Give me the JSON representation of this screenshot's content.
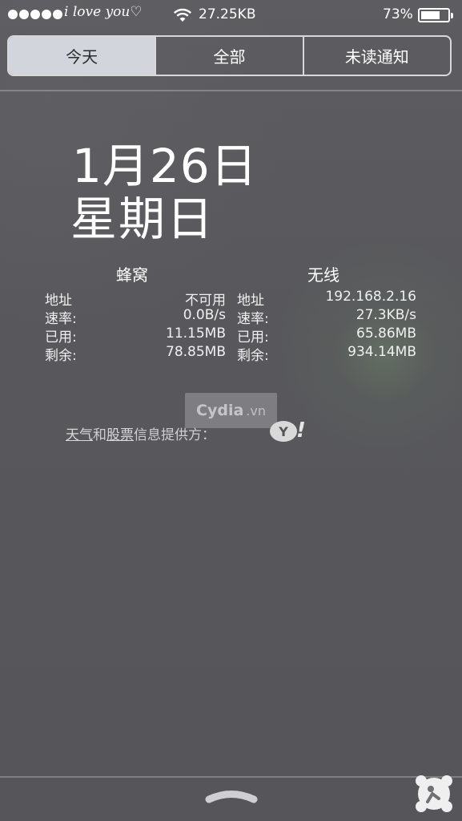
{
  "status_bar": {
    "carrier": "i love you♡",
    "network_speed": "27.25KB",
    "battery_percent": "73%",
    "battery_level": 0.73,
    "icons": [
      "signal-dots-icon",
      "wifi-icon",
      "battery-icon"
    ]
  },
  "tabs": [
    {
      "label": "今天",
      "active": true
    },
    {
      "label": "全部",
      "active": false
    },
    {
      "label": "未读通知",
      "active": false
    }
  ],
  "date": {
    "line1": "1月26日",
    "line2": "星期日"
  },
  "network": {
    "cellular_title": "蜂窝",
    "wifi_title": "无线",
    "rows": [
      {
        "cell_label": "地址",
        "cell_value": "不可用",
        "wifi_label": "地址",
        "wifi_value": "192.168.2.16"
      },
      {
        "cell_label": "速率:",
        "cell_value": "0.0B/s",
        "wifi_label": "速率:",
        "wifi_value": "27.3KB/s"
      },
      {
        "cell_label": "已用:",
        "cell_value": "11.15MB",
        "wifi_label": "已用:",
        "wifi_value": "65.86MB"
      },
      {
        "cell_label": "剩余:",
        "cell_value": "78.85MB",
        "wifi_label": "剩余:",
        "wifi_value": "934.14MB"
      }
    ]
  },
  "watermark": {
    "brand": "Cydia",
    "suffix": ".vn"
  },
  "provider": {
    "weather_link": "天气",
    "and": "和",
    "stocks_link": "股票",
    "rest": "信息提供方：",
    "yahoo_logo": "Y",
    "yahoo_bang": "!"
  },
  "colors": {
    "background": "#56565a",
    "active_tab_bg": "#d2d5db"
  }
}
